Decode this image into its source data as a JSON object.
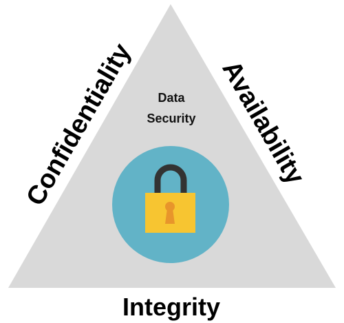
{
  "diagram": {
    "center_title": {
      "line1": "Data",
      "line2": "Security"
    },
    "sides": {
      "left": "Confidentiality",
      "right": "Availability",
      "bottom": "Integrity"
    },
    "icon": "padlock-icon",
    "colors": {
      "triangle": "#d9d9d9",
      "circle": "#62b3c7",
      "lock_body": "#f7c531",
      "lock_shackle": "#333333",
      "keyhole": "#e8952b",
      "text": "#000000"
    }
  }
}
